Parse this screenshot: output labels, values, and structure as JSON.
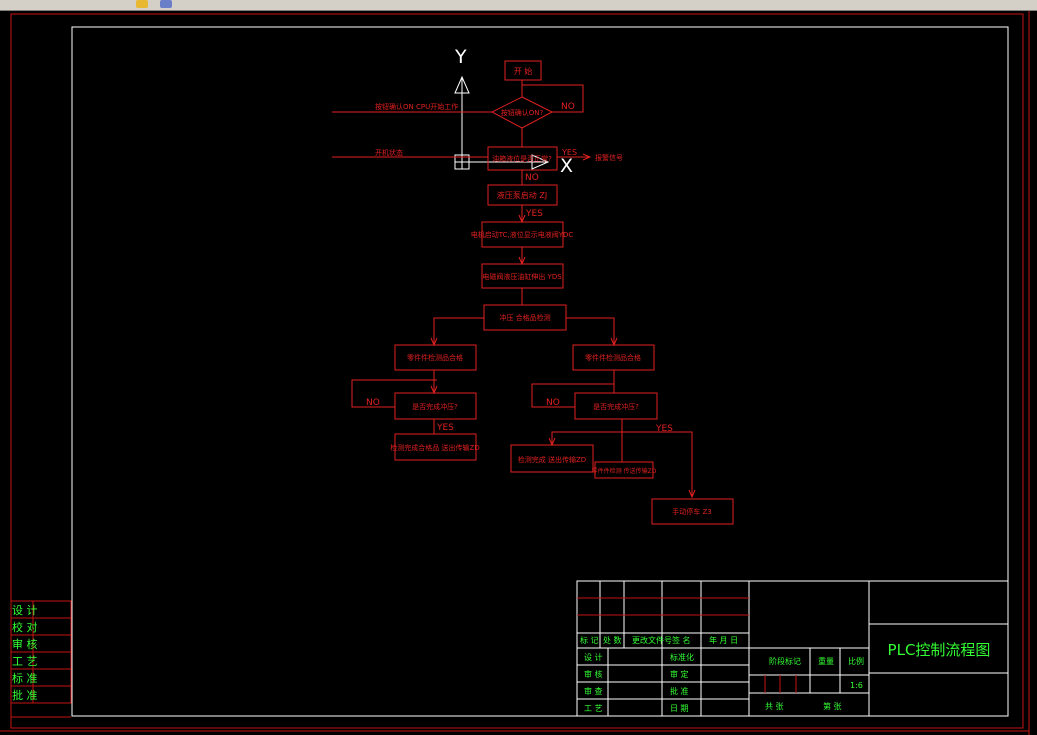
{
  "colors": {
    "background": "#000000",
    "frame_red": "#c41414",
    "flow_red": "#e02020",
    "white": "#ffffff",
    "green": "#33ff33",
    "toolbar": "#d4d0c8"
  },
  "toolbar": {
    "icons": [
      "toolbar-icon",
      "toolbar-icon"
    ]
  },
  "ucs": {
    "y_label": "Y",
    "x_label": "X"
  },
  "flow": {
    "start": "开 始",
    "decision1": "按钮确认ON?",
    "decision1_no": "NO",
    "input1": "按钮确认ON CPU开始工作",
    "input2": "开机状态",
    "decision2": "油箱液位是否正常?",
    "decision2_yes": "YES",
    "decision2_no": "NO",
    "alarm": "报警信号",
    "step1": "液压泵启动 ZJ",
    "step1_yes": "YES",
    "step2": "电机启动TC,液位显示电液阀YDC",
    "step3": "电磁阀液压油缸伸出 YDS",
    "step4": "冲压 合格品检测",
    "left_branch": "零件件检测品合格",
    "left_decision": "是否完成冲压?",
    "left_no": "NO",
    "left_yes": "YES",
    "left_result": "检测完成合格品 送出传输ZD",
    "right_branch": "零件件检测品合格",
    "right_decision": "是否完成冲压?",
    "right_no": "NO",
    "right_yes": "YES",
    "right_result1": "检测完成 送出传输ZD",
    "right_result2": "零件件检测 传送传输ZD",
    "right_result3": "手动停车 Z3"
  },
  "left_panel": {
    "rows": [
      "设 计",
      "校 对",
      "审 核",
      "工 艺",
      "标 准",
      "批 准"
    ]
  },
  "title_block": {
    "header_row": [
      "标 记",
      "处 数",
      "更改文件号",
      "签 名",
      "年 月 日"
    ],
    "left_labels": [
      "设 计",
      "审 核",
      "审 查",
      "工 艺"
    ],
    "mid_labels": [
      "标准化",
      "审 定",
      "批 准",
      "日 期"
    ],
    "stage_label": "阶段标记",
    "weight_label": "重量",
    "scale_label": "比例",
    "scale_value": "1:6",
    "sheet_total": "共 张",
    "sheet_num": "第 张",
    "drawing_title": "PLC控制流程图"
  }
}
